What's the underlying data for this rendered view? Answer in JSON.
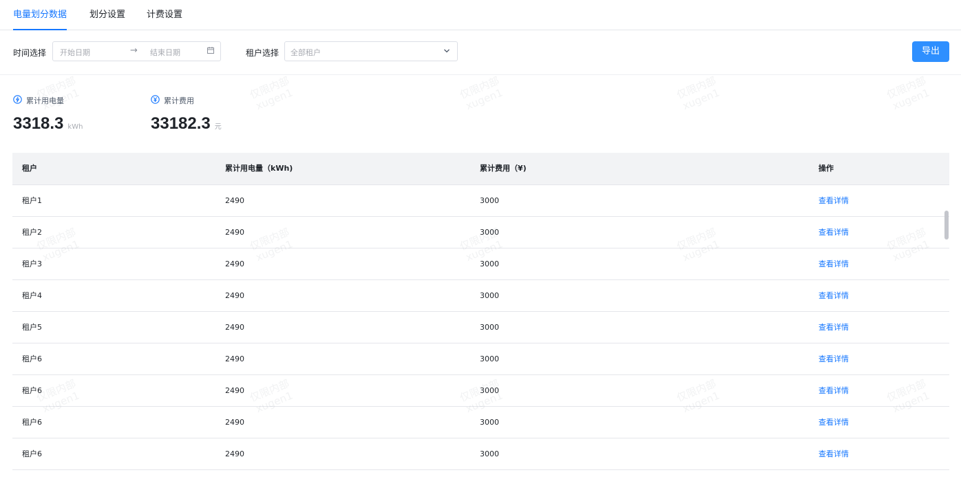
{
  "tabs": [
    {
      "label": "电量划分数据",
      "active": true
    },
    {
      "label": "划分设置",
      "active": false
    },
    {
      "label": "计费设置",
      "active": false
    }
  ],
  "filters": {
    "time_label": "时间选择",
    "start_placeholder": "开始日期",
    "range_separator": "→",
    "end_placeholder": "结束日期",
    "tenant_label": "租户选择",
    "tenant_value": "全部租户",
    "export_label": "导出"
  },
  "stats": {
    "energy": {
      "label": "累计用电量",
      "value": "3318.3",
      "unit": "kWh",
      "icon": "lightning-circle-icon"
    },
    "cost": {
      "label": "累计费用",
      "value": "33182.3",
      "unit": "元",
      "icon": "yuan-circle-icon"
    }
  },
  "table": {
    "headers": [
      "租户",
      "累计用电量（kWh)",
      "累计费用（¥)",
      "操作"
    ],
    "rows": [
      {
        "tenant": "租户1",
        "energy": "2490",
        "cost": "3000",
        "action": "查看详情"
      },
      {
        "tenant": "租户2",
        "energy": "2490",
        "cost": "3000",
        "action": "查看详情"
      },
      {
        "tenant": "租户3",
        "energy": "2490",
        "cost": "3000",
        "action": "查看详情"
      },
      {
        "tenant": "租户4",
        "energy": "2490",
        "cost": "3000",
        "action": "查看详情"
      },
      {
        "tenant": "租户5",
        "energy": "2490",
        "cost": "3000",
        "action": "查看详情"
      },
      {
        "tenant": "租户6",
        "energy": "2490",
        "cost": "3000",
        "action": "查看详情"
      },
      {
        "tenant": "租户6",
        "energy": "2490",
        "cost": "3000",
        "action": "查看详情"
      },
      {
        "tenant": "租户6",
        "energy": "2490",
        "cost": "3000",
        "action": "查看详情"
      },
      {
        "tenant": "租户6",
        "energy": "2490",
        "cost": "3000",
        "action": "查看详情"
      }
    ]
  },
  "watermark": {
    "line1": "仅限内部",
    "line2": "xugen1"
  },
  "colors": {
    "accent": "#1677ff",
    "button": "#2e8fff",
    "header_bg": "#f2f3f5",
    "border": "#e5e6eb"
  }
}
